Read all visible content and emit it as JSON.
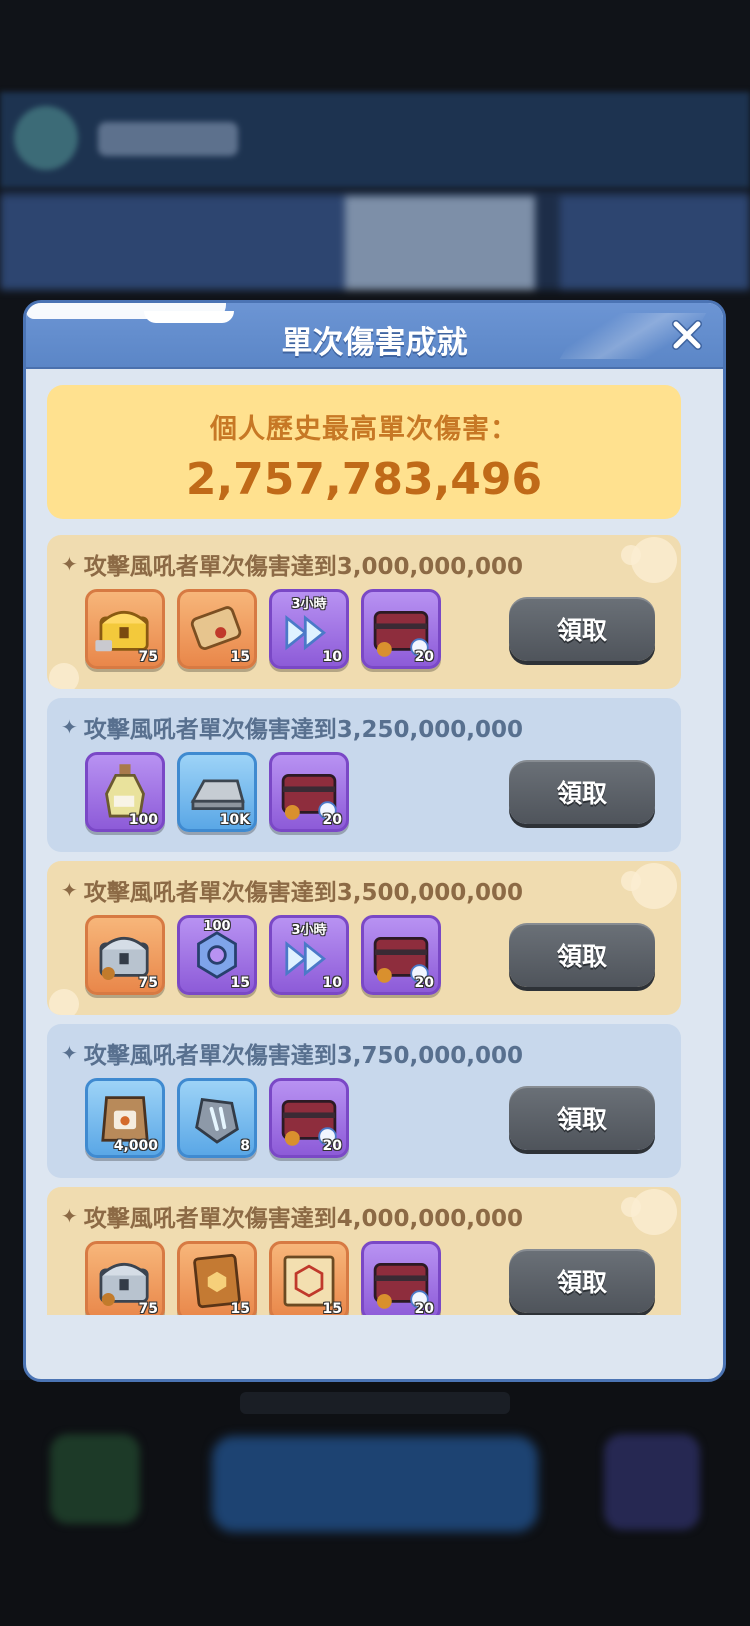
{
  "modal": {
    "title": "單次傷害成就",
    "record_label": "個人歷史最高單次傷害：",
    "record_value": "2,757,783,496"
  },
  "achievements": [
    {
      "title": "攻擊風吼者單次傷害達到3,000,000,000",
      "claim_label": "領取",
      "rewards": [
        {
          "icon": "gold-treasure-chest-icon",
          "qty": "75"
        },
        {
          "icon": "scroll-icon",
          "qty": "15"
        },
        {
          "icon": "time-skip-icon",
          "top_label": "3小時",
          "qty": "10"
        },
        {
          "icon": "red-chest-icon",
          "qty": "20"
        }
      ]
    },
    {
      "title": "攻擊風吼者單次傷害達到3,250,000,000",
      "claim_label": "領取",
      "rewards": [
        {
          "icon": "potion-bottle-icon",
          "qty": "100"
        },
        {
          "icon": "silver-ingot-icon",
          "qty": "10K"
        },
        {
          "icon": "red-chest-icon",
          "qty": "20"
        }
      ]
    },
    {
      "title": "攻擊風吼者單次傷害達到3,500,000,000",
      "claim_label": "領取",
      "rewards": [
        {
          "icon": "silver-treasure-chest-icon",
          "qty": "75"
        },
        {
          "icon": "hex-nut-icon",
          "top_label": "100",
          "qty": "15"
        },
        {
          "icon": "time-skip-icon",
          "top_label": "3小時",
          "qty": "10"
        },
        {
          "icon": "red-chest-icon",
          "qty": "20"
        }
      ]
    },
    {
      "title": "攻擊風吼者單次傷害達到3,750,000,000",
      "claim_label": "領取",
      "rewards": [
        {
          "icon": "pet-food-bag-icon",
          "qty": "4,000"
        },
        {
          "icon": "crystal-stone-icon",
          "qty": "8"
        },
        {
          "icon": "red-chest-icon",
          "qty": "20"
        }
      ]
    },
    {
      "title": "攻擊風吼者單次傷害達到4,000,000,000",
      "claim_label": "領取",
      "rewards": [
        {
          "icon": "silver-treasure-chest-icon",
          "qty": "75"
        },
        {
          "icon": "skill-book-icon",
          "qty": "15"
        },
        {
          "icon": "blueprint-scroll-icon",
          "qty": "15"
        },
        {
          "icon": "red-chest-icon",
          "qty": "20"
        }
      ]
    }
  ],
  "colors": {
    "header": "#5b86c7",
    "record_bg": "#ffe18f",
    "record_text": "#c06a18",
    "row_gold": "#f0dcb0",
    "row_blue": "#c8d8ec",
    "claim_button": "#5c6168"
  }
}
